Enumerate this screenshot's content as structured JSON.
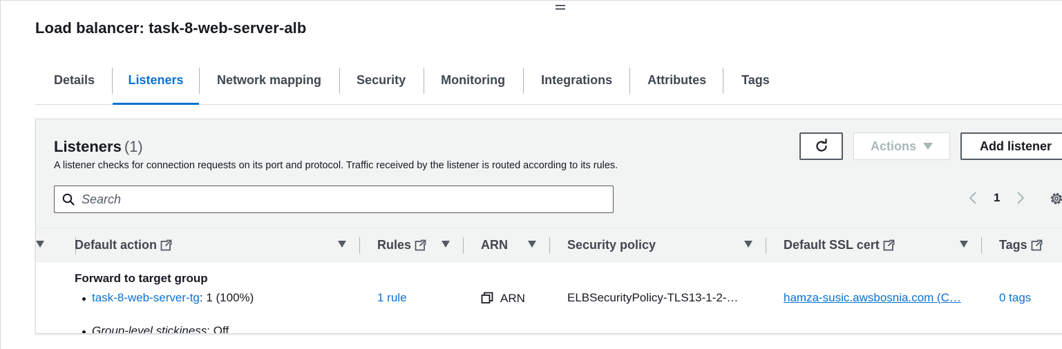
{
  "page": {
    "title": "Load balancer: task-8-web-server-alb"
  },
  "tabs": [
    {
      "label": "Details",
      "active": false
    },
    {
      "label": "Listeners",
      "active": true
    },
    {
      "label": "Network mapping",
      "active": false
    },
    {
      "label": "Security",
      "active": false
    },
    {
      "label": "Monitoring",
      "active": false
    },
    {
      "label": "Integrations",
      "active": false
    },
    {
      "label": "Attributes",
      "active": false
    },
    {
      "label": "Tags",
      "active": false
    }
  ],
  "listeners": {
    "title": "Listeners",
    "count": "(1)",
    "description": "A listener checks for connection requests on its port and protocol. Traffic received by the listener is routed according to its rules.",
    "buttons": {
      "actions": "Actions",
      "add": "Add listener"
    },
    "search_placeholder": "Search",
    "pagination": {
      "current_page": "1"
    },
    "columns": {
      "default_action": "Default action",
      "rules": "Rules",
      "arn": "ARN",
      "security_policy": "Security policy",
      "default_ssl_cert": "Default SSL cert",
      "tags": "Tags"
    },
    "row": {
      "default_action_title": "Forward to target group",
      "target_group_link": "task-8-web-server-tg",
      "target_group_weight": ": 1 (100%)",
      "stickiness_label": "Group-level stickiness",
      "stickiness_value": ": Off",
      "rules": "1 rule",
      "arn": "ARN",
      "security_policy": "ELBSecurityPolicy-TLS13-1-2-…",
      "ssl_cert": "hamza-susic.awsbosnia.com (C…",
      "tags": "0 tags"
    }
  },
  "colors": {
    "accent": "#0972d3",
    "text": "#16191f",
    "muted": "#545b64",
    "header_bg": "#f2f3f3",
    "border": "#d5dbdb"
  }
}
